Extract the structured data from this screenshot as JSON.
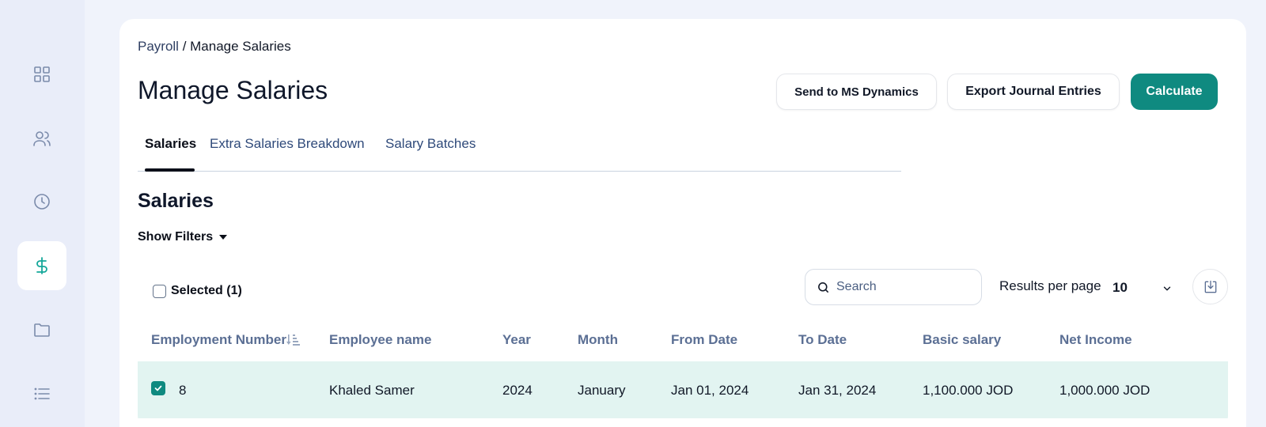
{
  "breadcrumb": {
    "parent": "Payroll",
    "separator": " / ",
    "current": "Manage Salaries"
  },
  "page_title": "Manage Salaries",
  "actions": {
    "send_ms_dynamics": "Send to MS Dynamics",
    "export_journal": "Export Journal Entries",
    "calculate": "Calculate"
  },
  "tabs": [
    {
      "label": "Salaries",
      "active": true
    },
    {
      "label": "Extra Salaries Breakdown",
      "active": false
    },
    {
      "label": "Salary Batches",
      "active": false
    }
  ],
  "section_title": "Salaries",
  "show_filters": "Show Filters",
  "selected": "Selected (1)",
  "search": {
    "placeholder": "Search",
    "value": ""
  },
  "results_per_page": {
    "label": "Results per page",
    "value": "10"
  },
  "table": {
    "columns": [
      "Employment Number",
      "Employee name",
      "Year",
      "Month",
      "From Date",
      "To Date",
      "Basic salary",
      "Net Income"
    ],
    "rows": [
      {
        "checked": true,
        "cells": [
          "8",
          "Khaled Samer",
          "2024",
          "January",
          "Jan 01, 2024",
          "Jan 31, 2024",
          "1,100.000 JOD",
          "1,000.000 JOD"
        ]
      }
    ]
  },
  "sidebar": {
    "items": [
      {
        "icon": "dashboard-grid-icon"
      },
      {
        "icon": "users-icon"
      },
      {
        "icon": "clock-icon"
      },
      {
        "icon": "dollar-icon",
        "active": true
      },
      {
        "icon": "folder-icon"
      },
      {
        "icon": "list-icon"
      }
    ]
  },
  "colors": {
    "accent": "#0f8a80",
    "row_selected": "#e2f4f1",
    "sidebar_bg": "#e9edf9",
    "header_text": "#5b6f94"
  }
}
